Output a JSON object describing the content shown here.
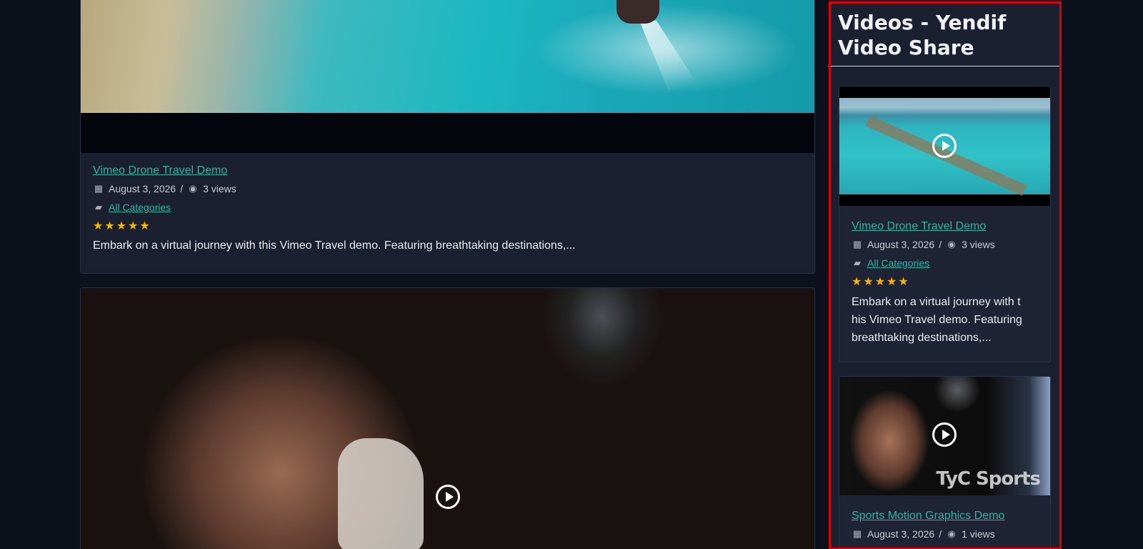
{
  "main": {
    "card1": {
      "title": "Vimeo Drone Travel Demo",
      "date": "August 3, 2026",
      "separator": "/",
      "views": "3 views",
      "category": "All Categories",
      "rating_stars": "★★★★★",
      "description": "Embark on a virtual journey with this Vimeo Travel demo. Featuring breathtaking destinations,..."
    }
  },
  "sidebar": {
    "title": "Videos - Yendif Video Share",
    "items": [
      {
        "title": "Vimeo Drone Travel Demo",
        "date": "August 3, 2026",
        "separator": "/",
        "views": "3 views",
        "category": "All Categories",
        "rating_stars": "★★★★★",
        "description": "Embark on a virtual journey with t his Vimeo Travel demo. Featuring breathtaking destinations,..."
      },
      {
        "title": "Sports Motion Graphics Demo",
        "date": "August 3, 2026",
        "separator": "/",
        "views": "1 views",
        "watermark": "TyC Sports"
      }
    ]
  },
  "icons": {
    "calendar": "calendar-icon",
    "eye": "eye-icon",
    "folder": "folder-icon",
    "play": "play-icon"
  },
  "colors": {
    "link": "#2fb3a2",
    "star": "#f5b301",
    "highlight": "#e10000",
    "page_bg": "#0d111c",
    "card_bg": "#1b2030"
  }
}
